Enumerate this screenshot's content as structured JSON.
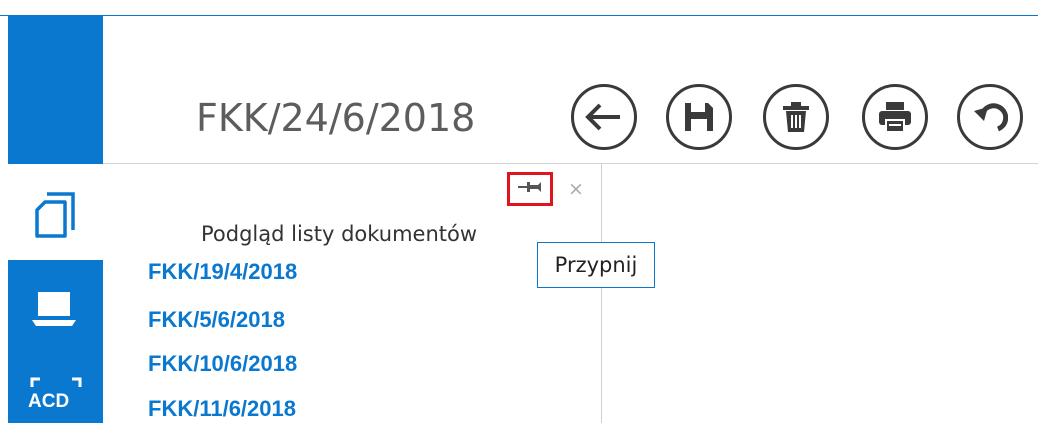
{
  "header": {
    "document_number": "FKK/24/6/2018",
    "accent_color": "#0b78d0"
  },
  "toolbar": {
    "buttons": [
      {
        "name": "back",
        "icon": "arrow-left-icon"
      },
      {
        "name": "save",
        "icon": "floppy-disk-icon"
      },
      {
        "name": "delete",
        "icon": "trash-icon"
      },
      {
        "name": "print",
        "icon": "printer-icon"
      },
      {
        "name": "undo",
        "icon": "undo-icon"
      }
    ]
  },
  "sidebar": {
    "items": [
      {
        "icon": "documents-icon",
        "active": true
      },
      {
        "icon": "laptop-icon",
        "active": false
      },
      {
        "icon": "acd-scan-icon",
        "label": "ACD",
        "active": false
      }
    ]
  },
  "panel": {
    "title": "Podgląd listy dokumentów",
    "pin_icon": "pin-icon",
    "close_symbol": "×",
    "tooltip": "Przypnij",
    "documents": [
      "FKK/19/4/2018",
      "FKK/5/6/2018",
      "FKK/10/6/2018",
      "FKK/11/6/2018"
    ]
  }
}
